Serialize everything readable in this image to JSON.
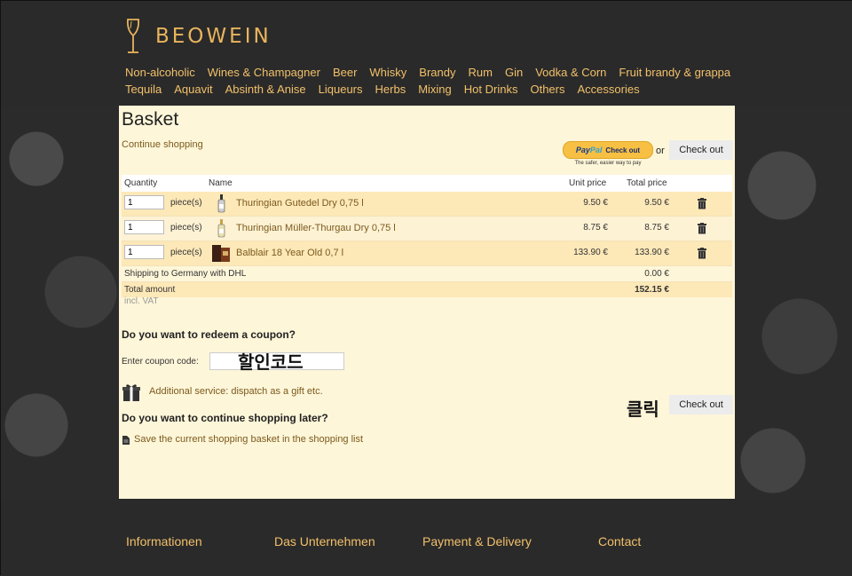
{
  "brand": {
    "name": "BEOWEIN",
    "accent": "#e9b45c"
  },
  "nav": {
    "row1": [
      "Non-alcoholic",
      "Wines & Champagner",
      "Beer",
      "Whisky",
      "Brandy",
      "Rum",
      "Gin",
      "Vodka & Corn",
      "Fruit brandy & grappa"
    ],
    "row2": [
      "Tequila",
      "Aquavit",
      "Absinth & Anise",
      "Liqueurs",
      "Herbs",
      "Mixing",
      "Hot Drinks",
      "Others",
      "Accessories"
    ]
  },
  "basket": {
    "title": "Basket",
    "continue_link": "Continue shopping",
    "paypal": {
      "brand1": "Pay",
      "brand2": "Pal",
      "label": "Check out",
      "tagline": "The safer, easier way to pay"
    },
    "or": "or",
    "checkout_label": "Check out",
    "columns": {
      "quantity": "Quantity",
      "name": "Name",
      "unit_price": "Unit price",
      "total_price": "Total price"
    },
    "items": [
      {
        "qty": "1",
        "unit": "piece(s)",
        "name": "Thuringian Gutedel Dry 0,75 l",
        "unit_price": "9.50 €",
        "total_price": "9.50 €",
        "icon": "bottle-icon"
      },
      {
        "qty": "1",
        "unit": "piece(s)",
        "name": "Thuringian Müller-Thurgau Dry 0,75 l",
        "unit_price": "8.75 €",
        "total_price": "8.75 €",
        "icon": "bottle-icon"
      },
      {
        "qty": "1",
        "unit": "piece(s)",
        "name": "Balblair 18 Year Old 0,7 l",
        "unit_price": "133.90 €",
        "total_price": "133.90 €",
        "icon": "whisky-box-icon"
      }
    ],
    "shipping_label": "Shipping to Germany with DHL",
    "shipping_value": "0.00 €",
    "total_label": "Total amount",
    "total_value": "152.15 €",
    "vat_note": "incl. VAT"
  },
  "coupon": {
    "heading": "Do you want to redeem a coupon?",
    "label": "Enter coupon code:",
    "annotation": "할인코드"
  },
  "gift": {
    "link": "Additional service: dispatch as a gift etc."
  },
  "later": {
    "heading": "Do you want to continue shopping later?",
    "link": "Save the current shopping basket in the shopping list"
  },
  "click_annotation": "클릭",
  "footer": {
    "links": [
      "Informationen",
      "Das Unternehmen",
      "Payment & Delivery",
      "Contact"
    ]
  }
}
